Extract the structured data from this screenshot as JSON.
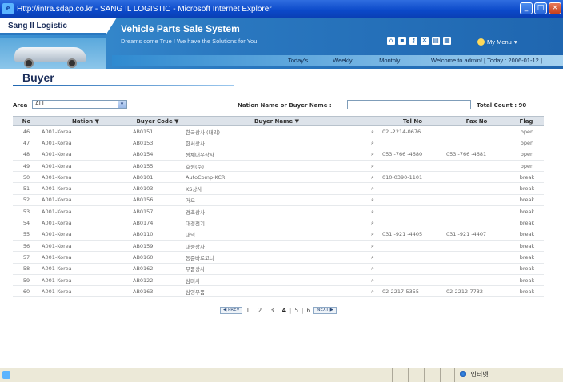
{
  "window": {
    "title": "Http://intra.sdap.co.kr - SANG IL LOGISTIC - Microsoft Internet Explorer",
    "controls": [
      "_",
      "□",
      "×"
    ]
  },
  "header": {
    "logo": "Sang Il Logistic",
    "system_title": "Vehicle Parts Sale System",
    "subtitle": "Dreams come True ! We have the Solutions for You",
    "tool_icons": [
      "home-icon",
      "save-icon",
      "key-icon",
      "close-icon",
      "print-icon",
      "grid-icon"
    ],
    "my_menu": "My Menu",
    "nav": {
      "today": "Today's",
      "weekly": ". Weekly",
      "monthly": ". Monthly"
    },
    "welcome": "Welcome to admin! [ Today : 2006-01-12 ]"
  },
  "page": {
    "title": "Buyer",
    "area_label": "Area",
    "area_value": "ALL",
    "search_label": "Nation Name or Buyer Name :",
    "search_value": "",
    "total_count": "Total Count : 90"
  },
  "columns": [
    "No",
    "Nation ▼",
    "Buyer Code ▼",
    "Buyer Name ▼",
    "",
    "Tel No",
    "Fax No",
    "Flag"
  ],
  "rows": [
    {
      "no": "46",
      "nation": "A001-Korea",
      "code": "AB0151",
      "name": "한국상사 (대리)",
      "tel": "02 -2214-0676",
      "fax": "",
      "flag": "open"
    },
    {
      "no": "47",
      "nation": "A001-Korea",
      "code": "AB0153",
      "name": "한서상사",
      "tel": "",
      "fax": "",
      "flag": "open"
    },
    {
      "no": "48",
      "nation": "A001-Korea",
      "code": "AB0154",
      "name": "쌍채대우상사",
      "tel": "053 -766 -4680",
      "fax": "053 -766 -4681",
      "flag": "open"
    },
    {
      "no": "49",
      "nation": "A001-Korea",
      "code": "AB0155",
      "name": "호원(주)",
      "tel": "",
      "fax": "",
      "flag": "open"
    },
    {
      "no": "50",
      "nation": "A001-Korea",
      "code": "AB0101",
      "name": "AutoComp-KCR",
      "tel": "010-0390-1101",
      "fax": "",
      "flag": "break"
    },
    {
      "no": "51",
      "nation": "A001-Korea",
      "code": "AB0103",
      "name": "KS상사",
      "tel": "",
      "fax": "",
      "flag": "break"
    },
    {
      "no": "52",
      "nation": "A001-Korea",
      "code": "AB0156",
      "name": "거오",
      "tel": "",
      "fax": "",
      "flag": "break"
    },
    {
      "no": "53",
      "nation": "A001-Korea",
      "code": "AB0157",
      "name": "경초상사",
      "tel": "",
      "fax": "",
      "flag": "break"
    },
    {
      "no": "54",
      "nation": "A001-Korea",
      "code": "AB0174",
      "name": "대경전기",
      "tel": "",
      "fax": "",
      "flag": "break"
    },
    {
      "no": "55",
      "nation": "A001-Korea",
      "code": "AB0110",
      "name": "대덕",
      "tel": "031 -921 -4405",
      "fax": "031 -921 -4407",
      "flag": "break"
    },
    {
      "no": "56",
      "nation": "A001-Korea",
      "code": "AB0159",
      "name": "대중상사",
      "tel": "",
      "fax": "",
      "flag": "break"
    },
    {
      "no": "57",
      "nation": "A001-Korea",
      "code": "AB0160",
      "name": "동준바로코너",
      "tel": "",
      "fax": "",
      "flag": "break"
    },
    {
      "no": "58",
      "nation": "A001-Korea",
      "code": "AB0162",
      "name": "부품상사",
      "tel": "",
      "fax": "",
      "flag": "break"
    },
    {
      "no": "59",
      "nation": "A001-Korea",
      "code": "AB0122",
      "name": "삼미사",
      "tel": "",
      "fax": "",
      "flag": "break"
    },
    {
      "no": "60",
      "nation": "A001-Korea",
      "code": "AB0163",
      "name": "삼영부품",
      "tel": "02-2217-5355",
      "fax": "02-2212-7732",
      "flag": "break"
    }
  ],
  "pagination": {
    "prev": "◀ PREV",
    "next": "NEXT ▶",
    "pages": [
      "1",
      "2",
      "3",
      "4",
      "5",
      "6"
    ],
    "current": "4"
  },
  "statusbar": {
    "zone": "인터넷"
  }
}
